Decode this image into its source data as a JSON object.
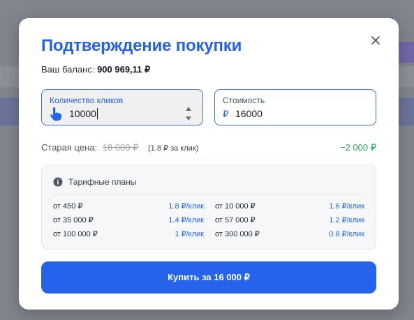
{
  "modal": {
    "title": "Подтверждение покупки",
    "balance_label": "Ваш баланс:",
    "balance_value": "900 969,11 ₽",
    "close_icon": "close-icon"
  },
  "quantity": {
    "label": "Количество кликов",
    "value": "10000",
    "icon": "hand-pointer-icon"
  },
  "cost": {
    "label": "Стоимость",
    "currency": "₽",
    "value": "16000"
  },
  "pricing": {
    "old_label": "Старая цена:",
    "old_value": "18 000 ₽",
    "per_click": "(1.8 ₽ за клик)",
    "discount": "−2 000 ₽"
  },
  "plans": {
    "title": "Тарифные планы",
    "rows": [
      {
        "from": "от 450 ₽",
        "rate": "1.8 ₽/клик"
      },
      {
        "from": "от 10 000 ₽",
        "rate": "1.6 ₽/клик"
      },
      {
        "from": "от 35 000 ₽",
        "rate": "1.4 ₽/клик"
      },
      {
        "from": "от 57 000 ₽",
        "rate": "1.2 ₽/клик"
      },
      {
        "from": "от 100 000 ₽",
        "rate": "1 ₽/клик"
      },
      {
        "from": "от 300 000 ₽",
        "rate": "0.8 ₽/клик"
      }
    ]
  },
  "buy_button": {
    "label": "Купить за 16 000 ₽"
  },
  "colors": {
    "accent": "#2563eb",
    "discount": "#22a55b"
  }
}
